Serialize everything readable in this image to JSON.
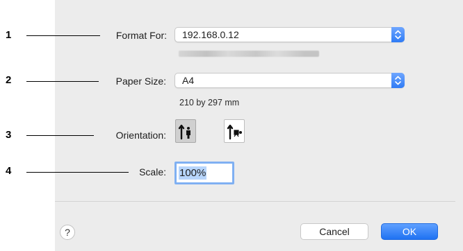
{
  "callouts": [
    "1",
    "2",
    "3",
    "4"
  ],
  "format_for": {
    "label": "Format For:",
    "value": "192.168.0.12",
    "subtitle_obscured": true
  },
  "paper_size": {
    "label": "Paper Size:",
    "value": "A4",
    "dimensions": "210 by 297 mm"
  },
  "orientation": {
    "label": "Orientation:",
    "options": [
      {
        "name": "portrait",
        "selected": true
      },
      {
        "name": "landscape",
        "selected": false
      }
    ]
  },
  "scale": {
    "label": "Scale:",
    "value": "100%"
  },
  "footer": {
    "help_label": "?",
    "cancel_label": "Cancel",
    "ok_label": "OK"
  },
  "colors": {
    "accent": "#2f7bf5",
    "dialog_bg": "#ececec",
    "focus_ring": "#7fb0f2"
  },
  "icons": [
    "stepper-icon",
    "portrait-orientation-icon",
    "landscape-orientation-icon",
    "help-icon"
  ]
}
